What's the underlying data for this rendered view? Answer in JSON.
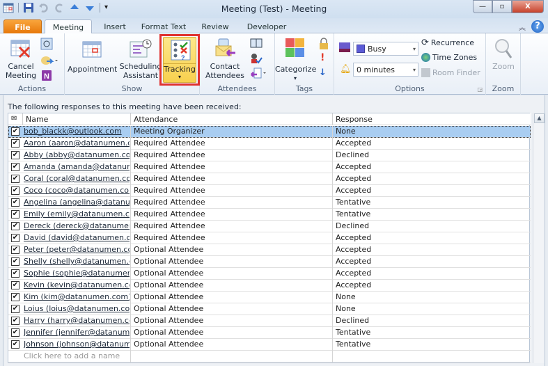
{
  "window": {
    "title": "Meeting (Test)  -  Meeting",
    "controls": {
      "minimize": "—",
      "maximize": "▫",
      "close": "X"
    }
  },
  "quick_access": {
    "icons": [
      "calendar-icon",
      "save-icon",
      "undo-icon",
      "redo-icon",
      "previous-item-icon",
      "next-item-icon",
      "customize-qat-icon"
    ]
  },
  "tabs": [
    {
      "label": "File"
    },
    {
      "label": "Meeting",
      "active": true
    },
    {
      "label": "Insert"
    },
    {
      "label": "Format Text"
    },
    {
      "label": "Review"
    },
    {
      "label": "Developer"
    }
  ],
  "ribbon": {
    "actions": {
      "label": "Actions",
      "cancel_meeting": "Cancel\nMeeting"
    },
    "show": {
      "label": "Show",
      "appointment": "Appointment",
      "scheduling": "Scheduling\nAssistant",
      "tracking": "Tracking"
    },
    "attendees": {
      "label": "Attendees",
      "contact_attendees": "Contact\nAttendees"
    },
    "tags": {
      "label": "Tags",
      "categorize": "Categorize"
    },
    "options": {
      "label": "Options",
      "show_as_value": "Busy",
      "reminder_value": "0 minutes",
      "recurrence": "Recurrence",
      "time_zones": "Time Zones",
      "room_finder": "Room Finder"
    },
    "zoom": {
      "label": "Zoom",
      "button": "Zoom"
    },
    "colors": {
      "tracking_highlight": "#e0312f",
      "category_red": "#e85a5a",
      "category_orange": "#f3b43e",
      "category_green": "#5cc25c",
      "category_blue": "#5b8fe6"
    }
  },
  "tracking": {
    "caption": "The following responses to this meeting have been received:",
    "columns": [
      "Name",
      "Attendance",
      "Response"
    ],
    "rows": [
      {
        "name": "bob_blackk@outlook.com",
        "attendance": "Meeting Organizer",
        "response": "None",
        "selected": true
      },
      {
        "name": "Aaron (aaron@datanumen.com",
        "attendance": "Required Attendee",
        "response": "Accepted"
      },
      {
        "name": "Abby (abby@datanumen.com)",
        "attendance": "Required Attendee",
        "response": "Declined"
      },
      {
        "name": "Amanda (amanda@datanumen.",
        "attendance": "Required Attendee",
        "response": "Accepted"
      },
      {
        "name": "Coral (coral@datanumen.com)",
        "attendance": "Required Attendee",
        "response": "Accepted"
      },
      {
        "name": "Coco (coco@datanumen.com)",
        "attendance": "Required Attendee",
        "response": "Accepted"
      },
      {
        "name": "Angelina (angelina@datanumen",
        "attendance": "Required Attendee",
        "response": "Tentative"
      },
      {
        "name": "Emily (emily@datanumen.com)",
        "attendance": "Required Attendee",
        "response": "Tentative"
      },
      {
        "name": "Dereck (dereck@datanumen.co",
        "attendance": "Required Attendee",
        "response": "Declined"
      },
      {
        "name": "David (david@datanumen.com)",
        "attendance": "Required Attendee",
        "response": "Accepted"
      },
      {
        "name": "Peter (peter@datanumen.com)",
        "attendance": "Optional Attendee",
        "response": "Accepted"
      },
      {
        "name": "Shelly (shelly@datanumen.com)",
        "attendance": "Optional Attendee",
        "response": "Accepted"
      },
      {
        "name": "Sophie (sophie@datanumen.co",
        "attendance": "Optional Attendee",
        "response": "Accepted"
      },
      {
        "name": "Kevin (kevin@datanumen.com)",
        "attendance": "Optional Attendee",
        "response": "Accepted"
      },
      {
        "name": "Kim (kim@datanumen.com)",
        "attendance": "Optional Attendee",
        "response": "None"
      },
      {
        "name": "Loius (loius@datanumen.com)",
        "attendance": "Optional Attendee",
        "response": "None"
      },
      {
        "name": "Harry (harry@datanumen.com)",
        "attendance": "Optional Attendee",
        "response": "Declined"
      },
      {
        "name": "Jennifer (jennifer@datanumen.",
        "attendance": "Optional Attendee",
        "response": "Tentative"
      },
      {
        "name": "Johnson (johnson@datanumen",
        "attendance": "Optional Attendee",
        "response": "Tentative"
      }
    ],
    "add_placeholder": "Click here to add a name"
  }
}
